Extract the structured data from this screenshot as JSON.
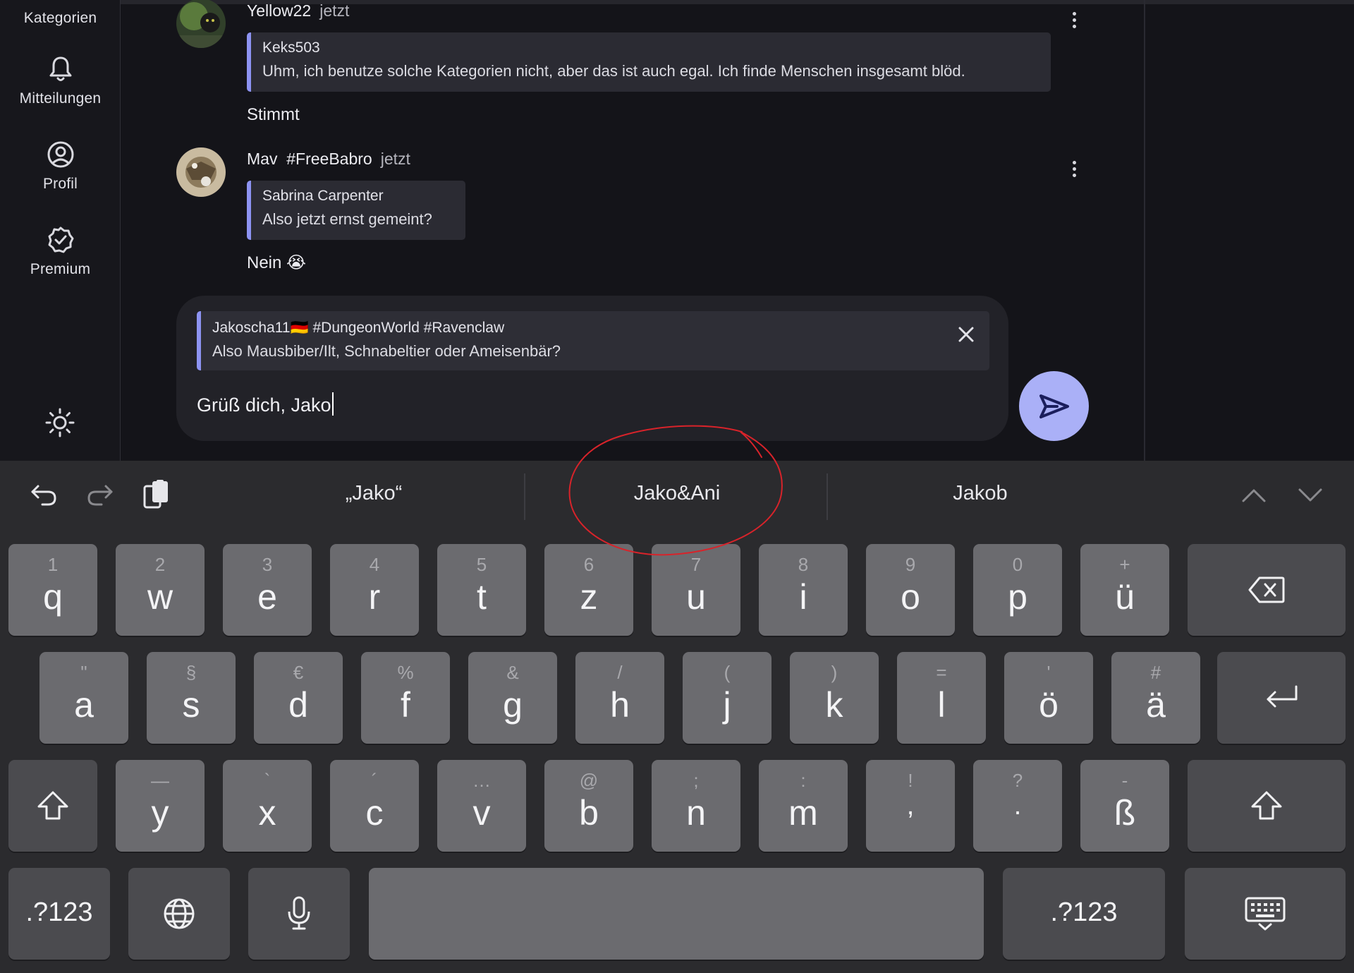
{
  "sidebar": {
    "items": [
      {
        "label": "Kategorien",
        "icon": "category-icon"
      },
      {
        "label": "Mitteilungen",
        "icon": "bell-icon"
      },
      {
        "label": "Profil",
        "icon": "profile-icon"
      },
      {
        "label": "Premium",
        "icon": "premium-badge-icon"
      }
    ],
    "theme_icon": "sun-icon"
  },
  "messages": [
    {
      "author": "Yellow22",
      "time": "jetzt",
      "quote": {
        "author": "Keks503",
        "text": "Uhm, ich benutze solche Kategorien nicht, aber das ist auch egal. Ich finde Menschen insgesamt blöd."
      },
      "text": "Stimmt"
    },
    {
      "author": "Mav  #FreeBabro",
      "time": "jetzt",
      "quote": {
        "author": "Sabrina Carpenter",
        "text": "Also jetzt ernst gemeint?"
      },
      "text": "Nein 😭"
    }
  ],
  "composer": {
    "reply_to": {
      "author": "Jakoscha11🇩🇪 #DungeonWorld #Ravenclaw",
      "text": "Also Mausbiber/Ilt, Schnabeltier oder Ameisenbär?"
    },
    "input_value": "Grüß dich, Jako",
    "send_icon": "send-icon",
    "close_icon": "close-icon"
  },
  "keyboard": {
    "suggestions": [
      "„Jako“",
      "Jako&Ani",
      "Jakob"
    ],
    "toolbar_icons": [
      "undo-icon",
      "redo-icon",
      "clipboard-icon",
      "chevron-up-icon",
      "chevron-down-icon"
    ],
    "row1": [
      {
        "main": "q",
        "sub": "1"
      },
      {
        "main": "w",
        "sub": "2"
      },
      {
        "main": "e",
        "sub": "3"
      },
      {
        "main": "r",
        "sub": "4"
      },
      {
        "main": "t",
        "sub": "5"
      },
      {
        "main": "z",
        "sub": "6"
      },
      {
        "main": "u",
        "sub": "7"
      },
      {
        "main": "i",
        "sub": "8"
      },
      {
        "main": "o",
        "sub": "9"
      },
      {
        "main": "p",
        "sub": "0"
      },
      {
        "main": "ü",
        "sub": "+"
      }
    ],
    "row2": [
      {
        "main": "a",
        "sub": "\""
      },
      {
        "main": "s",
        "sub": "§"
      },
      {
        "main": "d",
        "sub": "€"
      },
      {
        "main": "f",
        "sub": "%"
      },
      {
        "main": "g",
        "sub": "&"
      },
      {
        "main": "h",
        "sub": "/"
      },
      {
        "main": "j",
        "sub": "("
      },
      {
        "main": "k",
        "sub": ")"
      },
      {
        "main": "l",
        "sub": "="
      },
      {
        "main": "ö",
        "sub": "'"
      },
      {
        "main": "ä",
        "sub": "#"
      }
    ],
    "row3": [
      {
        "main": "y",
        "sub": "—"
      },
      {
        "main": "x",
        "sub": "`"
      },
      {
        "main": "c",
        "sub": "´"
      },
      {
        "main": "v",
        "sub": "…"
      },
      {
        "main": "b",
        "sub": "@"
      },
      {
        "main": "n",
        "sub": ";"
      },
      {
        "main": "m",
        "sub": ":"
      },
      {
        "main": ",",
        "sub": "!"
      },
      {
        "main": ".",
        "sub": "?"
      },
      {
        "main": "ß",
        "sub": "-"
      }
    ],
    "symbols_label": ".?123",
    "accent_color": "#aab0f7",
    "annotation_color": "#d8232a"
  }
}
